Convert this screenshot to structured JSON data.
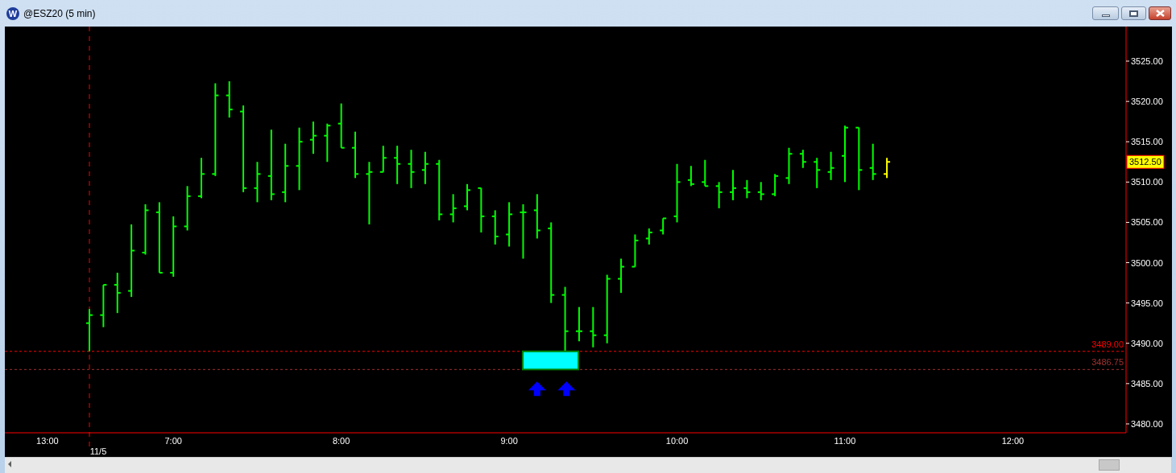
{
  "window": {
    "title": "@ESZ20 (5 min)",
    "logo": "W"
  },
  "chart": {
    "price_axis": [
      "3525.00",
      "3520.00",
      "3515.00",
      "3510.00",
      "3505.00",
      "3500.00",
      "3495.00",
      "3490.00",
      "3485.00",
      "3480.00"
    ],
    "time_axis": [
      "13:00",
      "7:00",
      "8:00",
      "9:00",
      "10:00",
      "11:00",
      "12:00"
    ],
    "date_label": "11/5",
    "levels": [
      {
        "label": "3489.00",
        "color": "#ff0000"
      },
      {
        "label": "3486.75",
        "color": "#a03030"
      }
    ],
    "zone": {
      "color": "#00ffff"
    },
    "last_price": "3512.50"
  }
}
